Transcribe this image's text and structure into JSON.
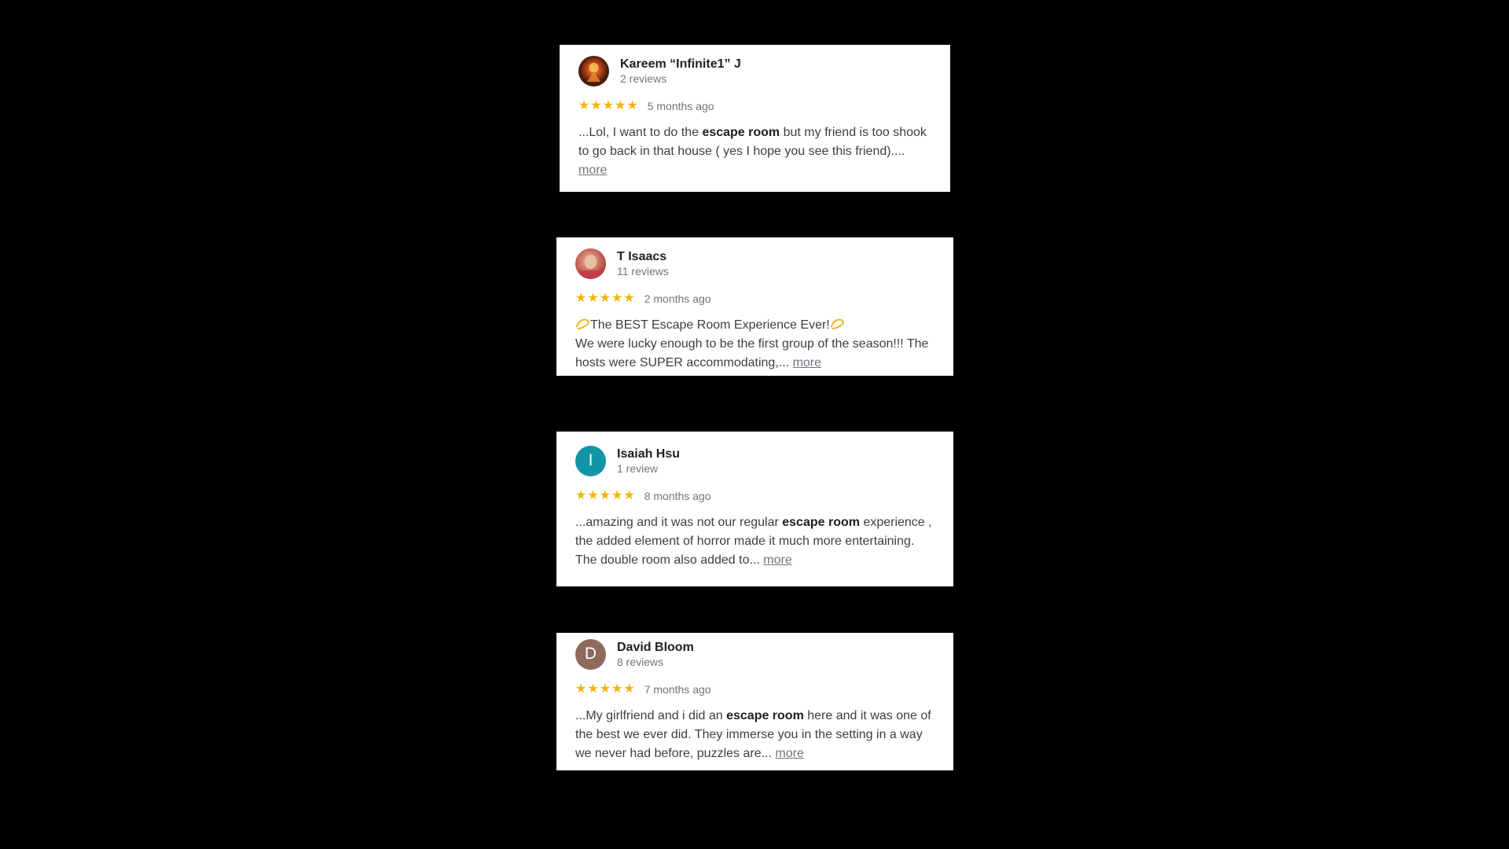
{
  "reviews": [
    {
      "name": "Kareem “Infinite1” J",
      "review_count": "2 reviews",
      "avatar": {
        "type": "photo",
        "icon": "profile-photo-icon"
      },
      "stars": 5,
      "time": "5 months ago",
      "text_before": "...Lol, I want to do the ",
      "highlight": "escape room",
      "text_after": " but my friend is too shook to go back in that house ( yes I hope you see this friend).... ",
      "more": "more"
    },
    {
      "name": "T Isaacs",
      "review_count": "11 reviews",
      "avatar": {
        "type": "photo",
        "icon": "profile-photo-icon"
      },
      "stars": 5,
      "time": "2 months ago",
      "headline": "The BEST Escape Room Experience Ever!",
      "headline_icon": "dizzy-emoji-icon",
      "text": "We were lucky enough to be the first group of the season!!! The hosts were SUPER accommodating,... ",
      "more": "more"
    },
    {
      "name": "Isaiah Hsu",
      "review_count": "1 review",
      "avatar": {
        "type": "letter",
        "letter": "I",
        "color": "#1296a6"
      },
      "stars": 5,
      "time": "8 months ago",
      "text_before": "...amazing and it was not our regular ",
      "highlight": "escape room",
      "text_after": " experience , the added element of horror made it much more entertaining. The double room also added to... ",
      "more": "more"
    },
    {
      "name": "David Bloom",
      "review_count": "8 reviews",
      "avatar": {
        "type": "letter",
        "letter": "D",
        "color": "#8c6b5c"
      },
      "stars": 5,
      "time": "7 months ago",
      "text_before": "...My girlfriend and i did an ",
      "highlight": "escape room",
      "text_after": " here and it was one of the best we ever did.  They immerse you in the setting in a way we never had before, puzzles are... ",
      "more": "more"
    }
  ],
  "colors": {
    "background": "#000000",
    "card": "#ffffff",
    "star": "#f4b400",
    "secondary_text": "#70757a"
  }
}
